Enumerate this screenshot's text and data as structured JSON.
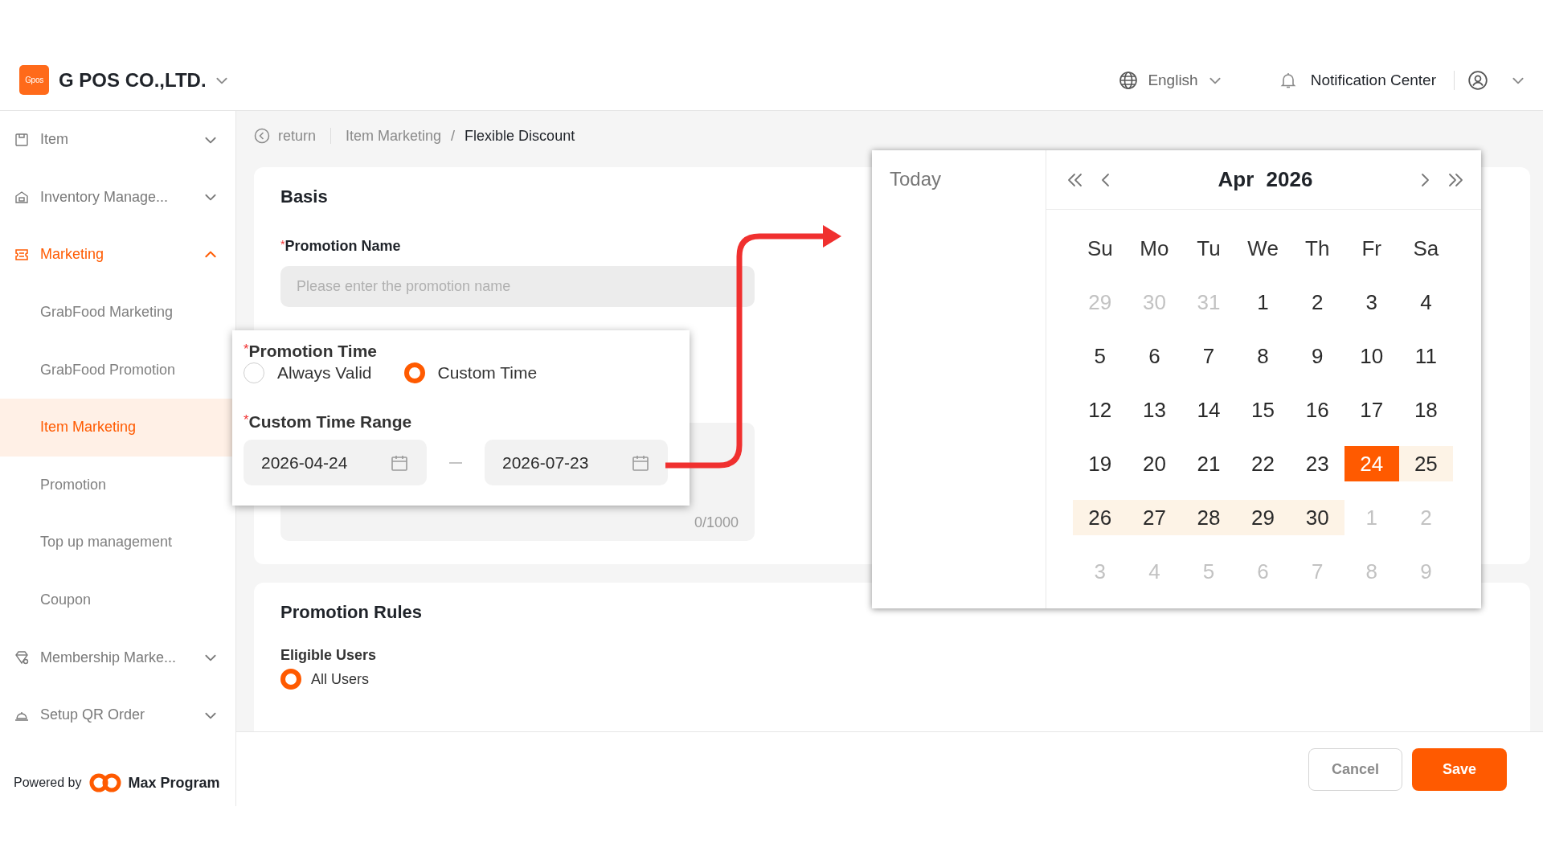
{
  "header": {
    "logo": "Gpos",
    "company": "G POS CO.,LTD.",
    "language": "English",
    "notification": "Notification Center"
  },
  "sidebar": {
    "items": [
      {
        "label": "Item",
        "expanded": false,
        "selected": false
      },
      {
        "label": "Inventory Manage...",
        "expanded": false,
        "selected": false
      },
      {
        "label": "Marketing",
        "expanded": true,
        "selected": true,
        "children": [
          {
            "label": "GrabFood Marketing",
            "selected": false
          },
          {
            "label": "GrabFood Promotion",
            "selected": false
          },
          {
            "label": "Item Marketing",
            "selected": true
          },
          {
            "label": "Promotion",
            "selected": false
          },
          {
            "label": "Top up management",
            "selected": false
          },
          {
            "label": "Coupon",
            "selected": false
          }
        ]
      },
      {
        "label": "Membership Marke...",
        "expanded": false,
        "selected": false
      },
      {
        "label": "Setup QR Order",
        "expanded": false,
        "selected": false
      }
    ],
    "powered_by": {
      "label": "Powered by",
      "brand": "Max Program"
    }
  },
  "breadcrumb": {
    "back": "return",
    "separator": "/",
    "items": [
      {
        "label": "Item Marketing",
        "current": false
      },
      {
        "label": "Flexible Discount",
        "current": true
      }
    ]
  },
  "basis": {
    "title": "Basis",
    "name_field": {
      "mark": "*",
      "label": "Promotion Name",
      "placeholder": "Please enter the promotion name"
    },
    "counter": "0/1000"
  },
  "promotion_time": {
    "mark": "*",
    "label": "Promotion Time",
    "options": [
      {
        "label": "Always Valid",
        "selected": false
      },
      {
        "label": "Custom Time",
        "selected": true
      }
    ],
    "range_mark": "*",
    "range_label": "Custom Time Range",
    "start": "2026-04-24",
    "end": "2026-07-23"
  },
  "calendar": {
    "today": "Today",
    "month": "Apr",
    "year": "2026",
    "weekdays": [
      "Su",
      "Mo",
      "Tu",
      "We",
      "Th",
      "Fr",
      "Sa"
    ],
    "weeks": [
      [
        {
          "day": "29",
          "in_month": false,
          "selected": false,
          "in_range": false
        },
        {
          "day": "30",
          "in_month": false,
          "selected": false,
          "in_range": false
        },
        {
          "day": "31",
          "in_month": false,
          "selected": false,
          "in_range": false
        },
        {
          "day": "1",
          "in_month": true,
          "selected": false,
          "in_range": false
        },
        {
          "day": "2",
          "in_month": true,
          "selected": false,
          "in_range": false
        },
        {
          "day": "3",
          "in_month": true,
          "selected": false,
          "in_range": false
        },
        {
          "day": "4",
          "in_month": true,
          "selected": false,
          "in_range": false
        }
      ],
      [
        {
          "day": "5",
          "in_month": true,
          "selected": false,
          "in_range": false
        },
        {
          "day": "6",
          "in_month": true,
          "selected": false,
          "in_range": false
        },
        {
          "day": "7",
          "in_month": true,
          "selected": false,
          "in_range": false
        },
        {
          "day": "8",
          "in_month": true,
          "selected": false,
          "in_range": false
        },
        {
          "day": "9",
          "in_month": true,
          "selected": false,
          "in_range": false
        },
        {
          "day": "10",
          "in_month": true,
          "selected": false,
          "in_range": false
        },
        {
          "day": "11",
          "in_month": true,
          "selected": false,
          "in_range": false
        }
      ],
      [
        {
          "day": "12",
          "in_month": true,
          "selected": false,
          "in_range": false
        },
        {
          "day": "13",
          "in_month": true,
          "selected": false,
          "in_range": false
        },
        {
          "day": "14",
          "in_month": true,
          "selected": false,
          "in_range": false
        },
        {
          "day": "15",
          "in_month": true,
          "selected": false,
          "in_range": false
        },
        {
          "day": "16",
          "in_month": true,
          "selected": false,
          "in_range": false
        },
        {
          "day": "17",
          "in_month": true,
          "selected": false,
          "in_range": false
        },
        {
          "day": "18",
          "in_month": true,
          "selected": false,
          "in_range": false
        }
      ],
      [
        {
          "day": "19",
          "in_month": true,
          "selected": false,
          "in_range": false
        },
        {
          "day": "20",
          "in_month": true,
          "selected": false,
          "in_range": false
        },
        {
          "day": "21",
          "in_month": true,
          "selected": false,
          "in_range": false
        },
        {
          "day": "22",
          "in_month": true,
          "selected": false,
          "in_range": false
        },
        {
          "day": "23",
          "in_month": true,
          "selected": false,
          "in_range": false
        },
        {
          "day": "24",
          "in_month": true,
          "selected": true,
          "in_range": true
        },
        {
          "day": "25",
          "in_month": true,
          "selected": false,
          "in_range": true
        }
      ],
      [
        {
          "day": "26",
          "in_month": true,
          "selected": false,
          "in_range": true
        },
        {
          "day": "27",
          "in_month": true,
          "selected": false,
          "in_range": true
        },
        {
          "day": "28",
          "in_month": true,
          "selected": false,
          "in_range": true
        },
        {
          "day": "29",
          "in_month": true,
          "selected": false,
          "in_range": true
        },
        {
          "day": "30",
          "in_month": true,
          "selected": false,
          "in_range": true
        },
        {
          "day": "1",
          "in_month": false,
          "selected": false,
          "in_range": false
        },
        {
          "day": "2",
          "in_month": false,
          "selected": false,
          "in_range": false
        }
      ],
      [
        {
          "day": "3",
          "in_month": false,
          "selected": false,
          "in_range": false
        },
        {
          "day": "4",
          "in_month": false,
          "selected": false,
          "in_range": false
        },
        {
          "day": "5",
          "in_month": false,
          "selected": false,
          "in_range": false
        },
        {
          "day": "6",
          "in_month": false,
          "selected": false,
          "in_range": false
        },
        {
          "day": "7",
          "in_month": false,
          "selected": false,
          "in_range": false
        },
        {
          "day": "8",
          "in_month": false,
          "selected": false,
          "in_range": false
        },
        {
          "day": "9",
          "in_month": false,
          "selected": false,
          "in_range": false
        }
      ]
    ]
  },
  "rules": {
    "title": "Promotion Rules",
    "eligible_label": "Eligible Users",
    "options": [
      {
        "label": "All Users",
        "selected": true
      }
    ]
  },
  "footer": {
    "buttons": [
      {
        "label": "Cancel",
        "kind": "secondary"
      },
      {
        "label": "Save",
        "kind": "primary"
      }
    ]
  }
}
